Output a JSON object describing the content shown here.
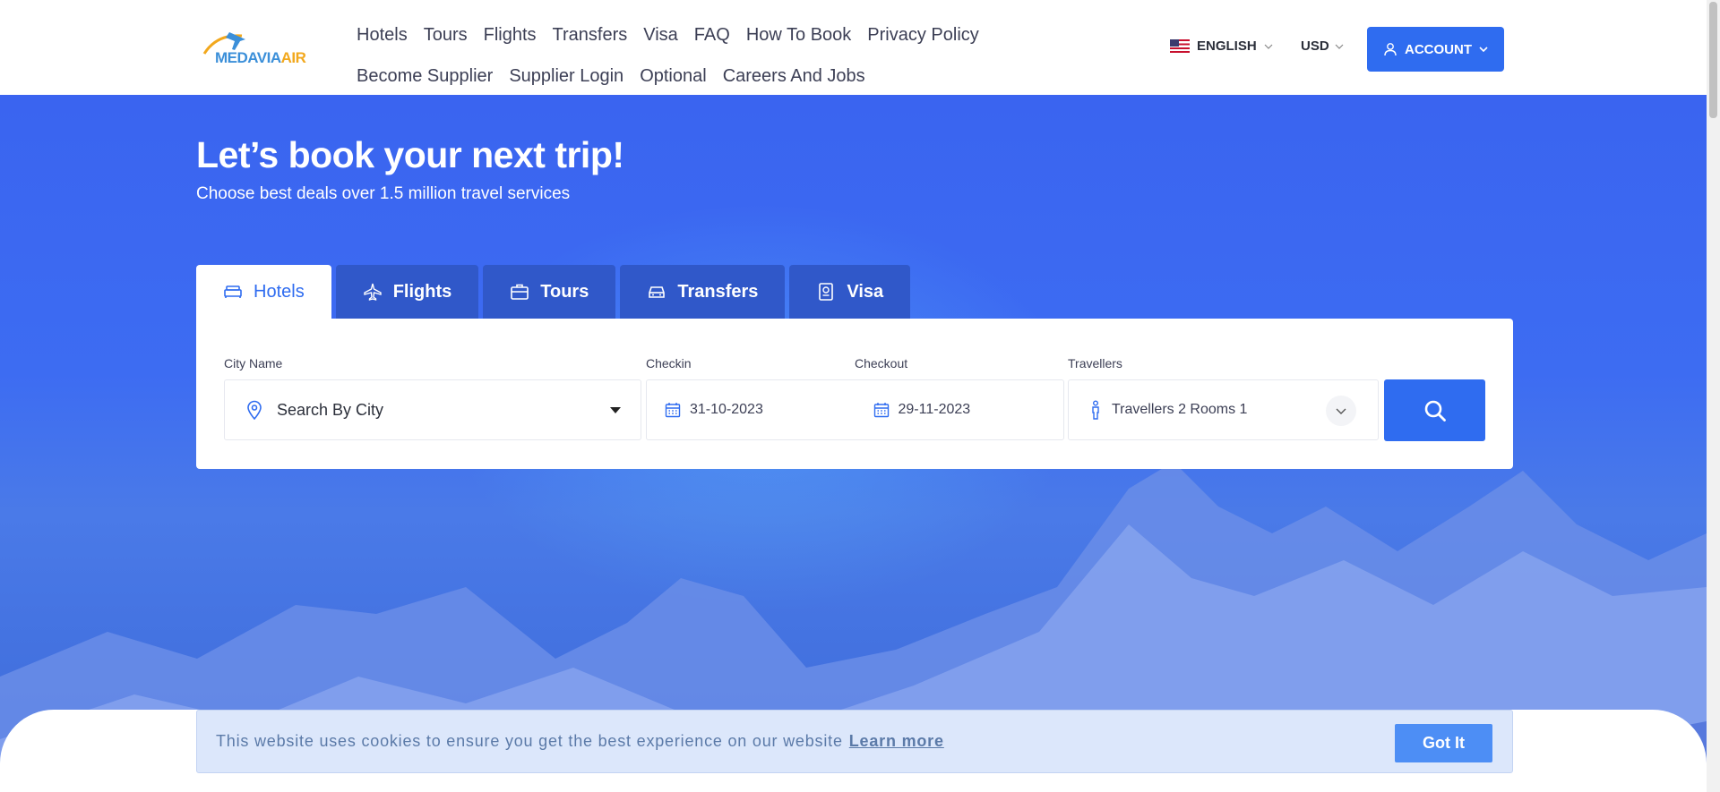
{
  "logo": {
    "part1": "MEDAVIA",
    "part2": "AIR"
  },
  "nav": {
    "row1": [
      "Hotels",
      "Tours",
      "Flights",
      "Transfers",
      "Visa",
      "FAQ",
      "How To Book",
      "Privacy Policy"
    ],
    "row2": [
      "Become Supplier",
      "Supplier Login",
      "Optional",
      "Careers And Jobs"
    ]
  },
  "language": {
    "label": "ENGLISH",
    "icon": "us-flag-icon"
  },
  "currency": {
    "label": "USD"
  },
  "account": {
    "label": "ACCOUNT"
  },
  "hero": {
    "title": "Let’s book your next trip!",
    "subtitle": "Choose best deals over 1.5 million travel services"
  },
  "tabs": [
    {
      "label": "Hotels",
      "icon": "bed-icon",
      "active": true
    },
    {
      "label": "Flights",
      "icon": "plane-icon",
      "active": false
    },
    {
      "label": "Tours",
      "icon": "suitcase-icon",
      "active": false
    },
    {
      "label": "Transfers",
      "icon": "car-icon",
      "active": false
    },
    {
      "label": "Visa",
      "icon": "passport-icon",
      "active": false
    }
  ],
  "search": {
    "city_label": "City Name",
    "city_value": "Search By City",
    "checkin_label": "Checkin",
    "checkin_value": "31-10-2023",
    "checkout_label": "Checkout",
    "checkout_value": "29-11-2023",
    "travellers_label": "Travellers",
    "travellers_value": "Travellers 2 Rooms 1"
  },
  "cookie": {
    "text": "This website uses cookies to ensure you get the best experience on our website",
    "link": "Learn more",
    "button": "Got It"
  },
  "colors": {
    "primary": "#2f6cf0",
    "hero": "#3a64f0",
    "tab_inactive": "#3058c9",
    "cookie_bg": "#dce7fb"
  }
}
